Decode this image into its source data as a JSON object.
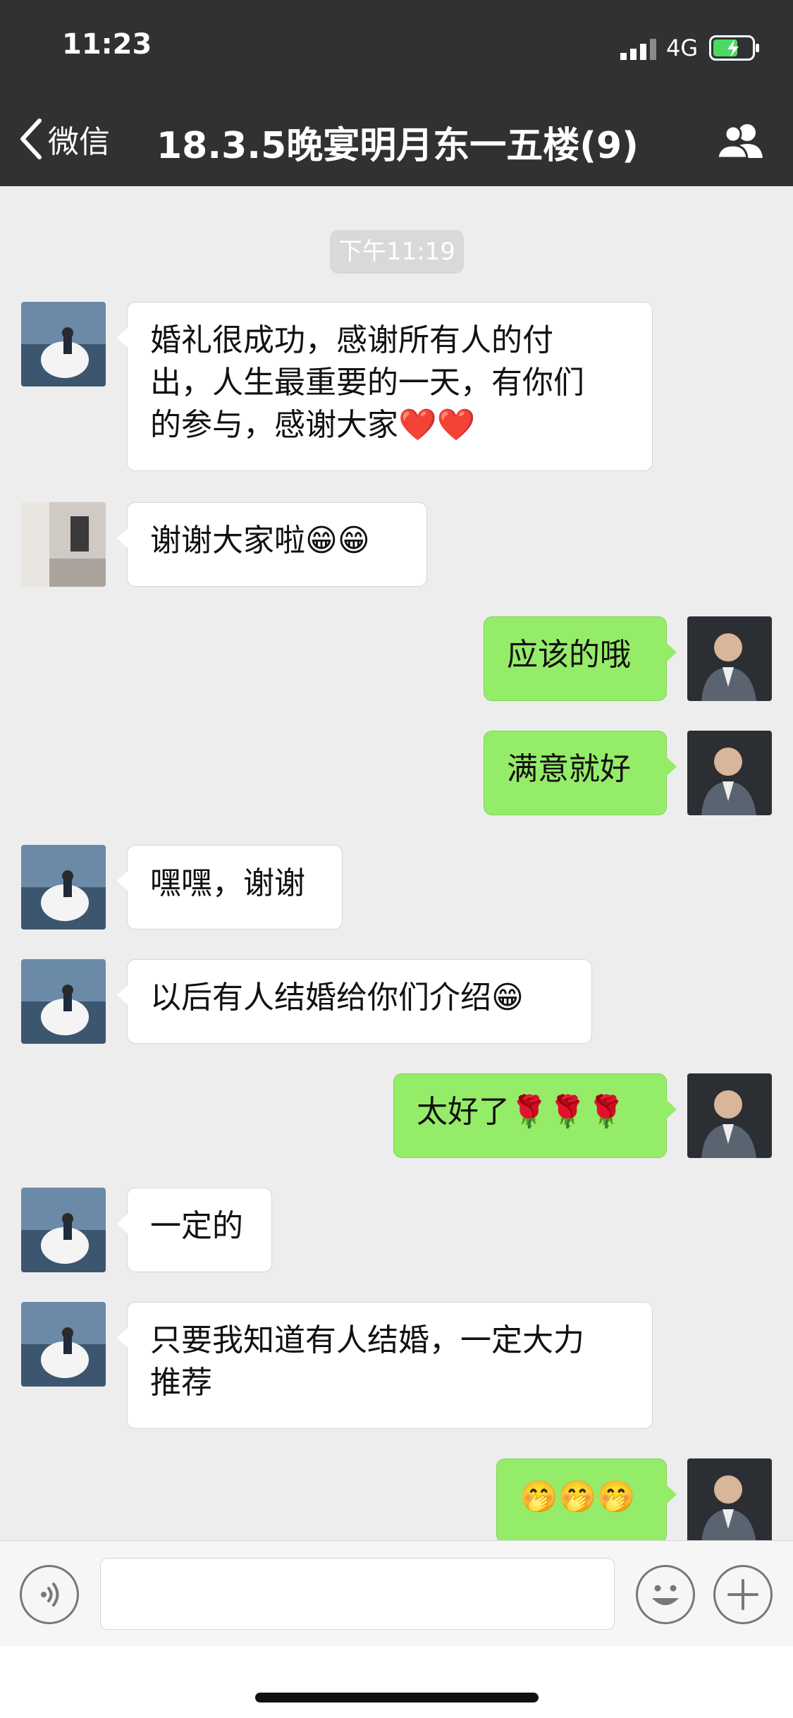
{
  "status_bar": {
    "time": "11:23",
    "network": "4G"
  },
  "nav": {
    "back_label": "微信",
    "title": "18.3.5晚宴明月东一五楼(9)",
    "members_icon": "group-members-icon"
  },
  "chat": {
    "timestamp": "下午11:19",
    "messages": [
      {
        "side": "in",
        "avatar": "bride-avatar",
        "lines": [
          "婚礼很成功，感谢所有人的付",
          "出，人生最重要的一天，有你们",
          "的参与，感谢大家❤️❤️"
        ]
      },
      {
        "side": "in",
        "avatar": "photo-avatar",
        "lines": [
          "谢谢大家啦😁😁"
        ]
      },
      {
        "side": "out",
        "avatar": "groom-avatar",
        "lines": [
          "应该的哦"
        ]
      },
      {
        "side": "out",
        "avatar": "groom-avatar",
        "lines": [
          "满意就好"
        ]
      },
      {
        "side": "in",
        "avatar": "bride-avatar",
        "lines": [
          "嘿嘿，谢谢"
        ]
      },
      {
        "side": "in",
        "avatar": "bride-avatar",
        "lines": [
          "以后有人结婚给你们介绍😁"
        ]
      },
      {
        "side": "out",
        "avatar": "groom-avatar",
        "lines": [
          "太好了🌹🌹🌹"
        ]
      },
      {
        "side": "in",
        "avatar": "bride-avatar",
        "lines": [
          "一定的"
        ]
      },
      {
        "side": "in",
        "avatar": "bride-avatar",
        "lines": [
          "只要我知道有人结婚，一定大力",
          "推荐"
        ]
      },
      {
        "side": "out",
        "avatar": "groom-avatar",
        "lines": [
          "🤭🤭🤭"
        ]
      }
    ]
  },
  "input_bar": {
    "voice_icon": "voice-icon",
    "emoji_icon": "emoji-icon",
    "plus_icon": "plus-icon",
    "value": ""
  },
  "colors": {
    "header_bg": "#2f3133",
    "chat_bg": "#ededed",
    "outgoing_bubble": "#95ec69",
    "incoming_bubble": "#ffffff"
  }
}
